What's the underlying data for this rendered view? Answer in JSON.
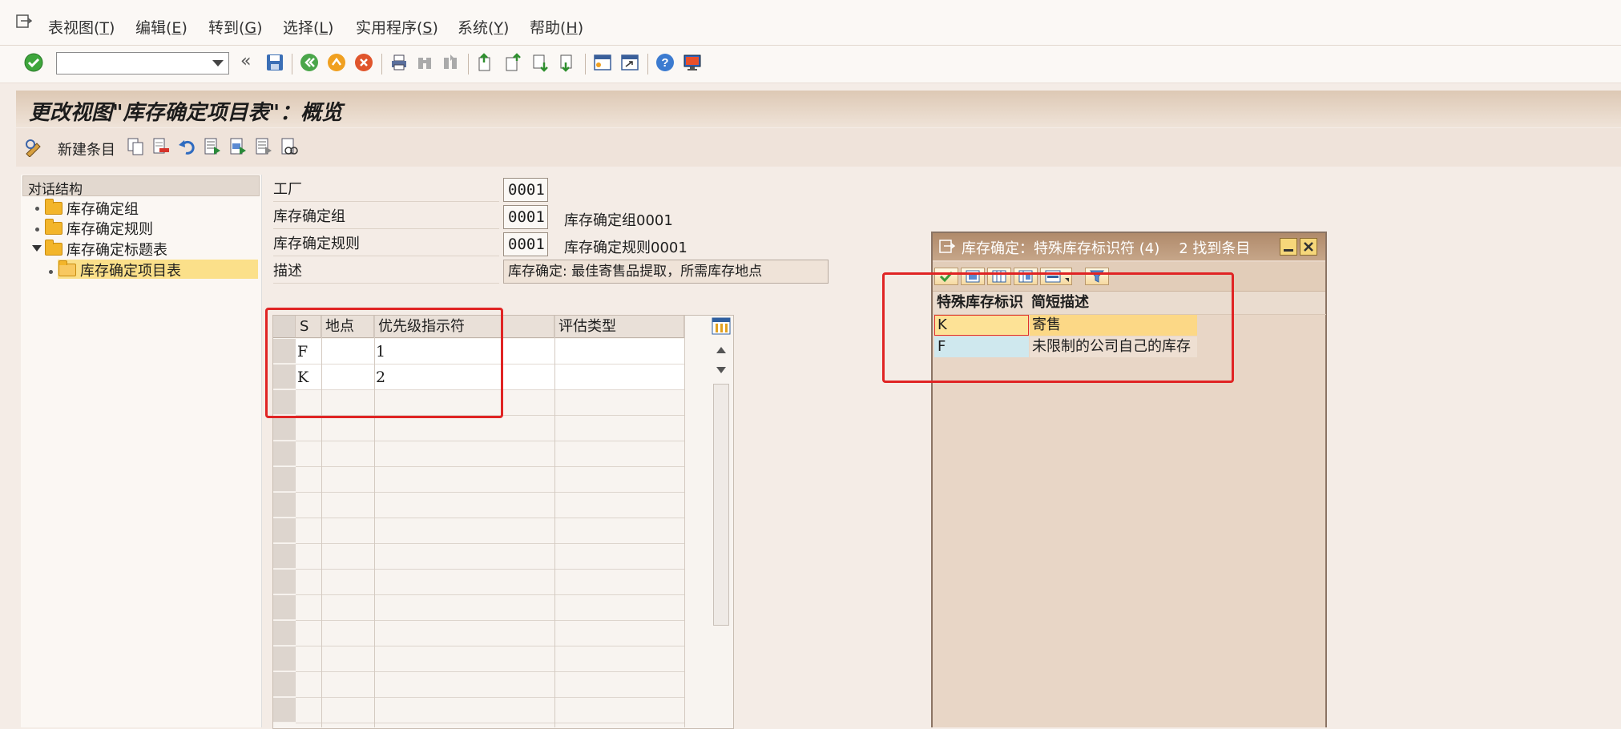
{
  "menu": [
    {
      "label": "表视图(",
      "key": "T",
      "tail": ")"
    },
    {
      "label": "编辑(",
      "key": "E",
      "tail": ")"
    },
    {
      "label": "转到(",
      "key": "G",
      "tail": ")"
    },
    {
      "label": "选择(",
      "key": "L",
      "tail": ")"
    },
    {
      "label": "实用程序(",
      "key": "S",
      "tail": ")"
    },
    {
      "label": "系统(",
      "key": "Y",
      "tail": ")"
    },
    {
      "label": "帮助(",
      "key": "H",
      "tail": ")"
    }
  ],
  "toolbar": {
    "command_value": "",
    "back_chevrons": "«"
  },
  "title": "更改视图\"库存确定项目表\"：概览",
  "app_toolbar": {
    "new_entry_label": "新建条目"
  },
  "dialog_structure": {
    "header": "对话结构",
    "items": [
      {
        "label": "库存确定组"
      },
      {
        "label": "库存确定规则"
      },
      {
        "label": "库存确定标题表"
      },
      {
        "label": "库存确定项目表"
      }
    ]
  },
  "form": {
    "plant_label": "工厂",
    "plant_value": "0001",
    "group_label": "库存确定组",
    "group_value": "0001",
    "group_desc": "库存确定组0001",
    "rule_label": "库存确定规则",
    "rule_value": "0001",
    "rule_desc": "库存确定规则0001",
    "desc_label": "描述",
    "desc_value": "库存确定: 最佳寄售品提取，所需库存地点"
  },
  "table": {
    "columns": [
      "S",
      "地点",
      "优先级指示符",
      "评估类型"
    ],
    "rows": [
      {
        "s": "F",
        "location": "",
        "priority": "1",
        "valuation": ""
      },
      {
        "s": "K",
        "location": "",
        "priority": "2",
        "valuation": ""
      }
    ]
  },
  "popup": {
    "title": "库存确定：特殊库存标识符 (4)",
    "count": "2 找到条目",
    "columns": [
      "特殊库存标识",
      "简短描述"
    ],
    "rows": [
      {
        "code": "K",
        "desc": "寄售"
      },
      {
        "code": "F",
        "desc": "未限制的公司自己的库存"
      }
    ]
  },
  "colors": {
    "highlight_box": "#e02424",
    "tree_selected": "#fbe08a",
    "popup_row_selected": "#fde296",
    "popup_row_alt": "#cfe8ee"
  }
}
